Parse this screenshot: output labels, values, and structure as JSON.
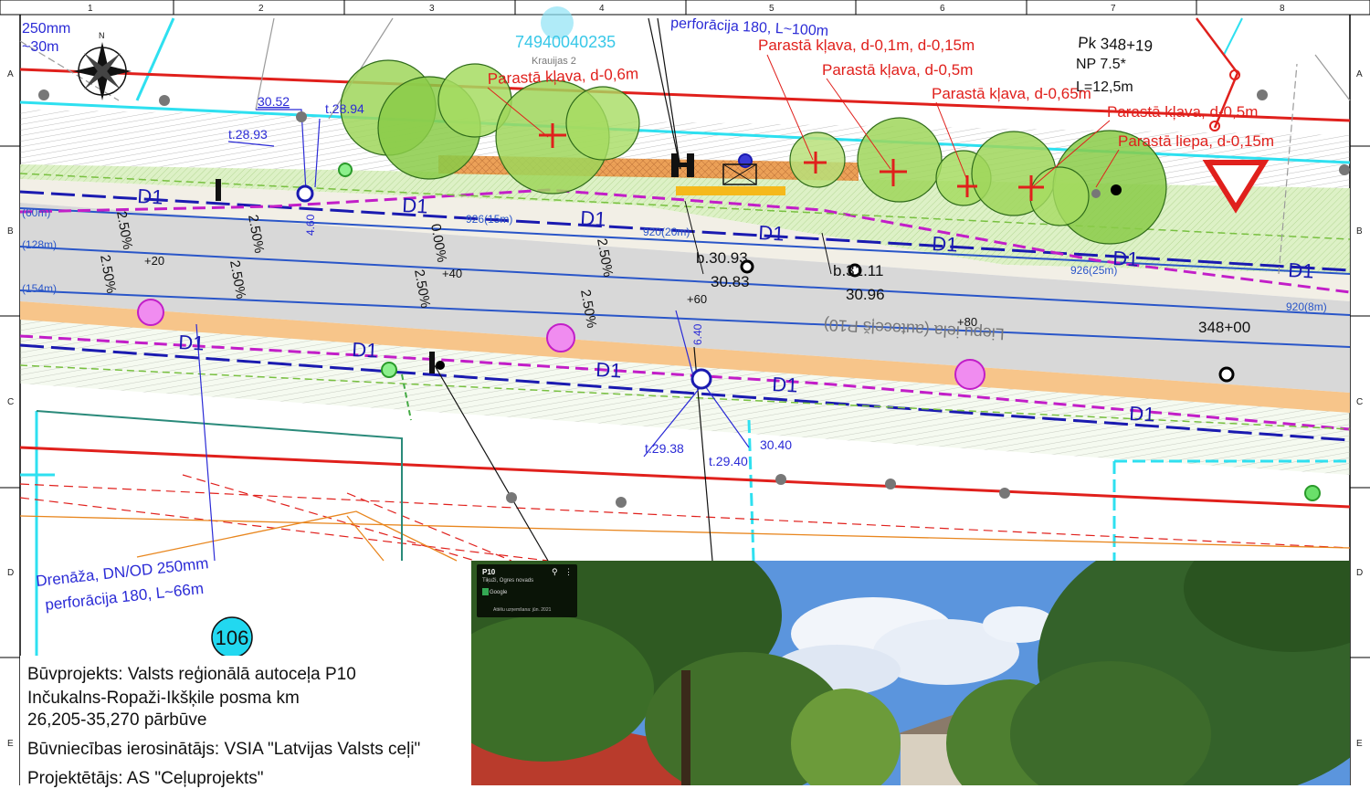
{
  "sheet": {
    "columns": [
      "1",
      "2",
      "3",
      "4",
      "5",
      "6",
      "7",
      "8"
    ],
    "rows": [
      "A",
      "B",
      "C",
      "D",
      "E"
    ]
  },
  "plan": {
    "cadastre_number": "74940040235",
    "address": "Krauijas 2",
    "drainage_top_left": [
      "250mm",
      "~30m"
    ],
    "drainage_top_center": "perforācija 180, L~100m",
    "drainage_bottom": [
      "Drenāža, DN/OD 250mm",
      "perforācija 180, L~66m"
    ],
    "chainage_box": [
      "Pk 348+19",
      "NP 7.5*",
      "L=12,5m"
    ],
    "tree_labels": [
      "Parastā kļava, d-0,6m",
      "Parastā kļava, d-0,1m, d-0,15m",
      "Parastā kļava, d-0,5m",
      "Parastā kļava, d-0,65m",
      "Parastā kļava, d-0,5m",
      "Parastā liepa, d-0,15m"
    ],
    "ditch_labels": [
      "D1",
      "D1",
      "D1",
      "D1",
      "D1",
      "D1",
      "D1",
      "D1",
      "D1",
      "D1",
      "D1",
      "D1"
    ],
    "elevations": [
      "30.52",
      "t.28.94",
      "t.28.93",
      "b.30.93",
      "30.83",
      "b.31.11",
      "30.96",
      "t.29.38",
      "30.40",
      "t.29.40"
    ],
    "slopes": [
      "2.50%",
      "2.50%",
      "2.50%",
      "2.50%",
      "0.00%",
      "2.50%",
      "2.50%",
      "2.50%"
    ],
    "pipe_labels": [
      "(60m)",
      "(128m)",
      "(154m)",
      "926(15m)",
      "920(20m)",
      "926(25m)",
      "920(8m)"
    ],
    "stations": [
      "+20",
      "+40",
      "+60",
      "+80",
      "348+00"
    ],
    "offsets": [
      "4.60",
      "6.40"
    ],
    "road_name": "Liepu iela (autoceļš P10)",
    "sheet_number": "106"
  },
  "info": {
    "lines": [
      "Būvprojekts: Valsts reģionālā autoceļa P10",
      "Inčukalns-Ropaži-Ikšķile posma km",
      "26,205-35,270 pārbūve",
      "Būvniecības ierosinātājs: VSIA \"Latvijas Valsts ceļi\"",
      "Projektētājs: AS \"Ceļuprojekts\""
    ]
  },
  "pano": {
    "title": "P10",
    "subtitle": "Tiķuži, Ogres novads",
    "brand": "Google",
    "date": "Attēlu uzņemšana: jūn. 2021"
  },
  "colors": {
    "red_line": "#e0201c",
    "cyan_line": "#2ee0f0",
    "blue_text": "#2b2bd6",
    "tree_green": "#9fd65a",
    "magenta_dash": "#c21ec8",
    "road_gray": "#d8d8d8",
    "shoulder_orange": "#f7c58a"
  },
  "icons": [
    "compass-rose-icon",
    "give-way-sign-icon",
    "manhole-icon",
    "tree-icon"
  ]
}
